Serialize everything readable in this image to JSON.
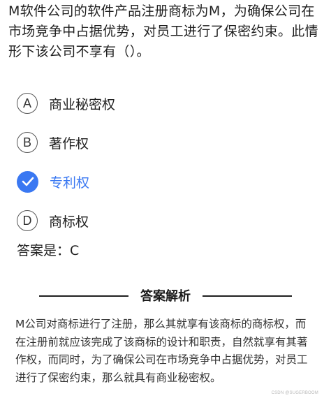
{
  "question": {
    "text": "M软件公司的软件产品注册商标为M，为确保公司在市场竞争中占据优势，对员工进行了保密约束。此情形下该公司不享有（）。"
  },
  "options": [
    {
      "letter": "A",
      "label": "商业秘密权",
      "selected": false
    },
    {
      "letter": "B",
      "label": "著作权",
      "selected": false
    },
    {
      "letter": "C",
      "label": "专利权",
      "selected": true
    },
    {
      "letter": "D",
      "label": "商标权",
      "selected": false
    }
  ],
  "answer": {
    "text": "答案是：C"
  },
  "analysis": {
    "title": "答案解析",
    "text": "M公司对商标进行了注册，那么其就享有该商标的商标权，而在注册前就应该完成了该商标的设计和职责，自然就享有其著作权，而同时，为了确保公司在市场竞争中占据优势，对员工进行了保密约束，那么就具有商业秘密权。"
  },
  "watermark": {
    "text": "CSDN @SUGERBOOM"
  },
  "colors": {
    "accent": "#3a78f2",
    "text": "#222222",
    "background": "#ffffff"
  },
  "icons": {
    "selected_marker": "check-icon"
  }
}
